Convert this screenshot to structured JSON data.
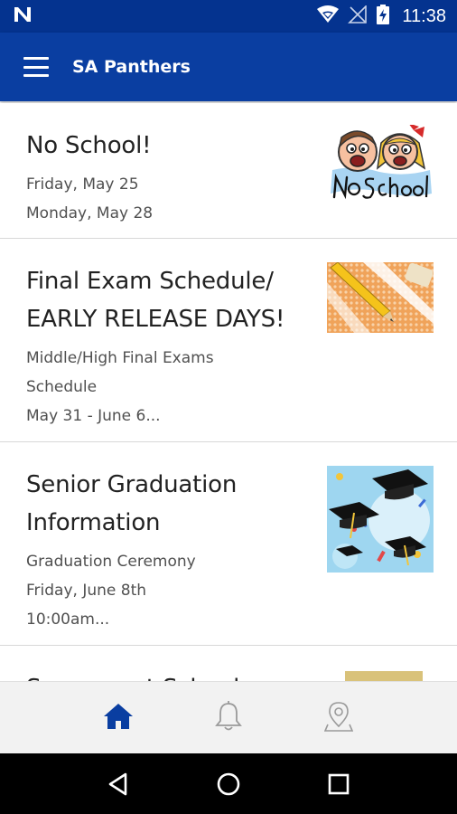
{
  "status_bar": {
    "time": "11:38",
    "icons": [
      "notification-n-icon",
      "wifi-icon",
      "no-signal-icon",
      "battery-charging-icon"
    ]
  },
  "app_bar": {
    "menu_icon": "hamburger-menu-icon",
    "title": "SA Panthers"
  },
  "news": [
    {
      "title": "No School!",
      "lines": [
        "Friday, May 25",
        "Monday, May 28"
      ],
      "image": "no-school-kids-image"
    },
    {
      "title": "Final Exam Schedule/ EARLY RELEASE DAYS!",
      "lines": [
        "Middle/High Final Exams",
        "Schedule",
        "May 31 - June 6..."
      ],
      "image": "pencil-answer-sheet-image"
    },
    {
      "title": "Senior Graduation Information",
      "lines": [
        "Graduation Ceremony",
        "Friday, June 8th",
        "10:00am..."
      ],
      "image": "graduation-caps-image"
    },
    {
      "title": "Summer at School",
      "lines": [],
      "image": "best-sign-image"
    }
  ],
  "bottom_nav": {
    "tabs": [
      {
        "name": "home",
        "icon": "home-icon",
        "active": true
      },
      {
        "name": "notifications",
        "icon": "bell-icon",
        "active": false
      },
      {
        "name": "locations",
        "icon": "map-pin-icon",
        "active": false
      }
    ]
  },
  "system_nav": [
    "back-icon",
    "home-circle-icon",
    "recents-icon"
  ],
  "colors": {
    "primary": "#0a3ea1",
    "status_bar": "#04338f",
    "active_tab": "#0a3ea1",
    "inactive_tab": "#9a9a9a"
  }
}
